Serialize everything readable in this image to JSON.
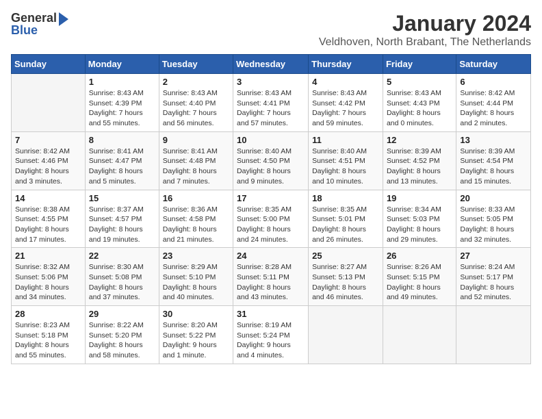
{
  "logo": {
    "general": "General",
    "blue": "Blue"
  },
  "header": {
    "month": "January 2024",
    "location": "Veldhoven, North Brabant, The Netherlands"
  },
  "weekdays": [
    "Sunday",
    "Monday",
    "Tuesday",
    "Wednesday",
    "Thursday",
    "Friday",
    "Saturday"
  ],
  "weeks": [
    [
      {
        "day": null
      },
      {
        "day": "1",
        "sunrise": "Sunrise: 8:43 AM",
        "sunset": "Sunset: 4:39 PM",
        "daylight": "Daylight: 7 hours",
        "daylight2": "and 55 minutes."
      },
      {
        "day": "2",
        "sunrise": "Sunrise: 8:43 AM",
        "sunset": "Sunset: 4:40 PM",
        "daylight": "Daylight: 7 hours",
        "daylight2": "and 56 minutes."
      },
      {
        "day": "3",
        "sunrise": "Sunrise: 8:43 AM",
        "sunset": "Sunset: 4:41 PM",
        "daylight": "Daylight: 7 hours",
        "daylight2": "and 57 minutes."
      },
      {
        "day": "4",
        "sunrise": "Sunrise: 8:43 AM",
        "sunset": "Sunset: 4:42 PM",
        "daylight": "Daylight: 7 hours",
        "daylight2": "and 59 minutes."
      },
      {
        "day": "5",
        "sunrise": "Sunrise: 8:43 AM",
        "sunset": "Sunset: 4:43 PM",
        "daylight": "Daylight: 8 hours",
        "daylight2": "and 0 minutes."
      },
      {
        "day": "6",
        "sunrise": "Sunrise: 8:42 AM",
        "sunset": "Sunset: 4:44 PM",
        "daylight": "Daylight: 8 hours",
        "daylight2": "and 2 minutes."
      }
    ],
    [
      {
        "day": "7",
        "sunrise": "Sunrise: 8:42 AM",
        "sunset": "Sunset: 4:46 PM",
        "daylight": "Daylight: 8 hours",
        "daylight2": "and 3 minutes."
      },
      {
        "day": "8",
        "sunrise": "Sunrise: 8:41 AM",
        "sunset": "Sunset: 4:47 PM",
        "daylight": "Daylight: 8 hours",
        "daylight2": "and 5 minutes."
      },
      {
        "day": "9",
        "sunrise": "Sunrise: 8:41 AM",
        "sunset": "Sunset: 4:48 PM",
        "daylight": "Daylight: 8 hours",
        "daylight2": "and 7 minutes."
      },
      {
        "day": "10",
        "sunrise": "Sunrise: 8:40 AM",
        "sunset": "Sunset: 4:50 PM",
        "daylight": "Daylight: 8 hours",
        "daylight2": "and 9 minutes."
      },
      {
        "day": "11",
        "sunrise": "Sunrise: 8:40 AM",
        "sunset": "Sunset: 4:51 PM",
        "daylight": "Daylight: 8 hours",
        "daylight2": "and 10 minutes."
      },
      {
        "day": "12",
        "sunrise": "Sunrise: 8:39 AM",
        "sunset": "Sunset: 4:52 PM",
        "daylight": "Daylight: 8 hours",
        "daylight2": "and 13 minutes."
      },
      {
        "day": "13",
        "sunrise": "Sunrise: 8:39 AM",
        "sunset": "Sunset: 4:54 PM",
        "daylight": "Daylight: 8 hours",
        "daylight2": "and 15 minutes."
      }
    ],
    [
      {
        "day": "14",
        "sunrise": "Sunrise: 8:38 AM",
        "sunset": "Sunset: 4:55 PM",
        "daylight": "Daylight: 8 hours",
        "daylight2": "and 17 minutes."
      },
      {
        "day": "15",
        "sunrise": "Sunrise: 8:37 AM",
        "sunset": "Sunset: 4:57 PM",
        "daylight": "Daylight: 8 hours",
        "daylight2": "and 19 minutes."
      },
      {
        "day": "16",
        "sunrise": "Sunrise: 8:36 AM",
        "sunset": "Sunset: 4:58 PM",
        "daylight": "Daylight: 8 hours",
        "daylight2": "and 21 minutes."
      },
      {
        "day": "17",
        "sunrise": "Sunrise: 8:35 AM",
        "sunset": "Sunset: 5:00 PM",
        "daylight": "Daylight: 8 hours",
        "daylight2": "and 24 minutes."
      },
      {
        "day": "18",
        "sunrise": "Sunrise: 8:35 AM",
        "sunset": "Sunset: 5:01 PM",
        "daylight": "Daylight: 8 hours",
        "daylight2": "and 26 minutes."
      },
      {
        "day": "19",
        "sunrise": "Sunrise: 8:34 AM",
        "sunset": "Sunset: 5:03 PM",
        "daylight": "Daylight: 8 hours",
        "daylight2": "and 29 minutes."
      },
      {
        "day": "20",
        "sunrise": "Sunrise: 8:33 AM",
        "sunset": "Sunset: 5:05 PM",
        "daylight": "Daylight: 8 hours",
        "daylight2": "and 32 minutes."
      }
    ],
    [
      {
        "day": "21",
        "sunrise": "Sunrise: 8:32 AM",
        "sunset": "Sunset: 5:06 PM",
        "daylight": "Daylight: 8 hours",
        "daylight2": "and 34 minutes."
      },
      {
        "day": "22",
        "sunrise": "Sunrise: 8:30 AM",
        "sunset": "Sunset: 5:08 PM",
        "daylight": "Daylight: 8 hours",
        "daylight2": "and 37 minutes."
      },
      {
        "day": "23",
        "sunrise": "Sunrise: 8:29 AM",
        "sunset": "Sunset: 5:10 PM",
        "daylight": "Daylight: 8 hours",
        "daylight2": "and 40 minutes."
      },
      {
        "day": "24",
        "sunrise": "Sunrise: 8:28 AM",
        "sunset": "Sunset: 5:11 PM",
        "daylight": "Daylight: 8 hours",
        "daylight2": "and 43 minutes."
      },
      {
        "day": "25",
        "sunrise": "Sunrise: 8:27 AM",
        "sunset": "Sunset: 5:13 PM",
        "daylight": "Daylight: 8 hours",
        "daylight2": "and 46 minutes."
      },
      {
        "day": "26",
        "sunrise": "Sunrise: 8:26 AM",
        "sunset": "Sunset: 5:15 PM",
        "daylight": "Daylight: 8 hours",
        "daylight2": "and 49 minutes."
      },
      {
        "day": "27",
        "sunrise": "Sunrise: 8:24 AM",
        "sunset": "Sunset: 5:17 PM",
        "daylight": "Daylight: 8 hours",
        "daylight2": "and 52 minutes."
      }
    ],
    [
      {
        "day": "28",
        "sunrise": "Sunrise: 8:23 AM",
        "sunset": "Sunset: 5:18 PM",
        "daylight": "Daylight: 8 hours",
        "daylight2": "and 55 minutes."
      },
      {
        "day": "29",
        "sunrise": "Sunrise: 8:22 AM",
        "sunset": "Sunset: 5:20 PM",
        "daylight": "Daylight: 8 hours",
        "daylight2": "and 58 minutes."
      },
      {
        "day": "30",
        "sunrise": "Sunrise: 8:20 AM",
        "sunset": "Sunset: 5:22 PM",
        "daylight": "Daylight: 9 hours",
        "daylight2": "and 1 minute."
      },
      {
        "day": "31",
        "sunrise": "Sunrise: 8:19 AM",
        "sunset": "Sunset: 5:24 PM",
        "daylight": "Daylight: 9 hours",
        "daylight2": "and 4 minutes."
      },
      {
        "day": null
      },
      {
        "day": null
      },
      {
        "day": null
      }
    ]
  ]
}
